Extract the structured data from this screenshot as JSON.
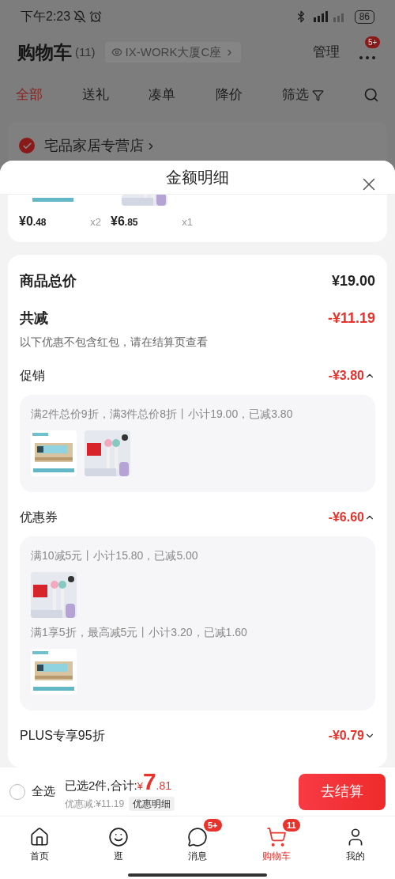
{
  "status_bar": {
    "time": "下午2:23",
    "battery": "86"
  },
  "header": {
    "title": "购物车",
    "count": "(11)",
    "address": "IX-WORK大厦C座",
    "manage": "管理",
    "more_badge": "5+"
  },
  "tabs": [
    {
      "label": "全部",
      "selected": true
    },
    {
      "label": "送礼",
      "selected": false
    },
    {
      "label": "凑单",
      "selected": false
    },
    {
      "label": "降价",
      "selected": false
    },
    {
      "label": "筛选",
      "selected": false,
      "kind": "filter"
    }
  ],
  "store": {
    "name": "宅品家居专营店",
    "checked": true
  },
  "sheet": {
    "title": "金额明细",
    "items": [
      {
        "kind": "tissue",
        "price": "¥0",
        "cents": ".48",
        "qty": "x2"
      },
      {
        "kind": "toothbrush",
        "price": "¥6",
        "cents": ".85",
        "qty": "x1"
      }
    ],
    "total_label": "商品总价",
    "total": "¥19.00",
    "reduce_label": "共减",
    "reduce": "-¥11.19",
    "note": "以下优惠不包含红包，请在结算页查看",
    "sections": [
      {
        "label": "促销",
        "amount": "-¥3.80",
        "expanded": true,
        "groups": [
          {
            "rule": "满2件总价9折，满3件总价8折丨小计19.00，已减3.80",
            "products": [
              {
                "kind": "tissue"
              },
              {
                "kind": "toothbrush"
              }
            ]
          }
        ]
      },
      {
        "label": "优惠券",
        "amount": "-¥6.60",
        "expanded": true,
        "groups": [
          {
            "rule": "满10减5元丨小计15.80，已减5.00",
            "products": [
              {
                "kind": "toothbrush"
              }
            ]
          },
          {
            "rule": "满1享5折，最高减5元丨小计3.20，已减1.60",
            "products": [
              {
                "kind": "tissue"
              }
            ]
          }
        ]
      },
      {
        "label": "PLUS专享95折",
        "amount": "-¥0.79",
        "expanded": false
      }
    ]
  },
  "footer": {
    "select_all": {
      "label": "全选",
      "checked": false
    },
    "selected_text": "已选2件,合计:",
    "currency": "¥",
    "total": "7",
    "cents": ".81",
    "discount": "优惠减:¥11.19",
    "detail_button": "优惠明细",
    "checkout": "去结算"
  },
  "nav": [
    {
      "label": "首页",
      "kind": "home",
      "selected": false
    },
    {
      "label": "逛",
      "kind": "browse",
      "selected": false
    },
    {
      "label": "消息",
      "kind": "message",
      "selected": false,
      "badge": "5+"
    },
    {
      "label": "购物车",
      "kind": "cart",
      "selected": true,
      "badge": "11"
    },
    {
      "label": "我的",
      "kind": "me",
      "selected": false
    }
  ]
}
